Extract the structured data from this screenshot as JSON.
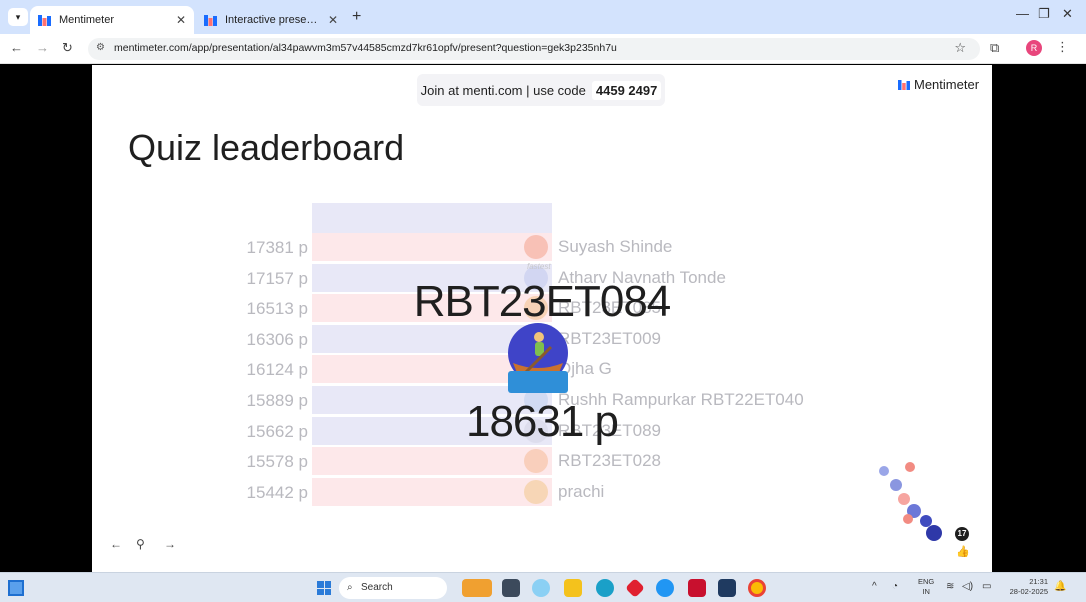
{
  "browser": {
    "tabs": [
      {
        "title": "Mentimeter",
        "active": true
      },
      {
        "title": "Interactive presentation softwa",
        "active": false
      }
    ],
    "tab_menu_icon": "chevron-down-icon",
    "new_tab_label": "+",
    "url": "mentimeter.com/app/presentation/al34pawvm3m57v44585cmzd7kr61opfv/present?question=gek3p235nh7u",
    "profile_initial": "R",
    "accent": "#d3e3fd"
  },
  "slide": {
    "join_text": "Join at menti.com | use code",
    "join_code": "4459 2497",
    "brand": "Mentimeter",
    "title": "Quiz leaderboard",
    "leaderboard": [
      {
        "score": "17381 p",
        "name": "Suyash Shinde",
        "bar": "pink",
        "avatar_color": "#f5b0a0"
      },
      {
        "score": "17157 p",
        "name": "Atharv Navnath Tonde",
        "bar": "blue",
        "avatar_color": "#c9cff0"
      },
      {
        "score": "16513 p",
        "name": "RBT23ET085",
        "bar": "pink",
        "avatar_color": "#f4c9a0"
      },
      {
        "score": "16306 p",
        "name": "RBT23ET009",
        "bar": "blue",
        "avatar_color": "#d7c7f0"
      },
      {
        "score": "16124 p",
        "name": "Ojha G",
        "bar": "pink",
        "avatar_color": "#f0d3b0"
      },
      {
        "score": "15889 p",
        "name": "Rushh Rampurkar RBT22ET040",
        "bar": "blue",
        "avatar_color": "#c8d4f0"
      },
      {
        "score": "15662 p",
        "name": "RBT23ET089",
        "bar": "blue",
        "avatar_color": "#d8d8e8"
      },
      {
        "score": "15578 p",
        "name": "RBT23ET028",
        "bar": "pink",
        "avatar_color": "#f7c4a8"
      },
      {
        "score": "15442 p",
        "name": "prachi",
        "bar": "pink",
        "avatar_color": "#f3cfa0"
      }
    ],
    "fastest_label": "fastest",
    "winner": {
      "name": "RBT23ET084",
      "score": "18631 p"
    },
    "nav": {
      "prev": "←",
      "pin": "⚲",
      "next": "→"
    },
    "reactions_count": "17",
    "colors": {
      "pink_bar": "#fde8ea",
      "blue_bar": "#e8e8f7",
      "faded_text": "#b9b9bf"
    }
  },
  "taskbar": {
    "search_label": "Search",
    "lang_line1": "ENG",
    "lang_line2": "IN",
    "time": "21:31",
    "date": "28-02-2025"
  }
}
